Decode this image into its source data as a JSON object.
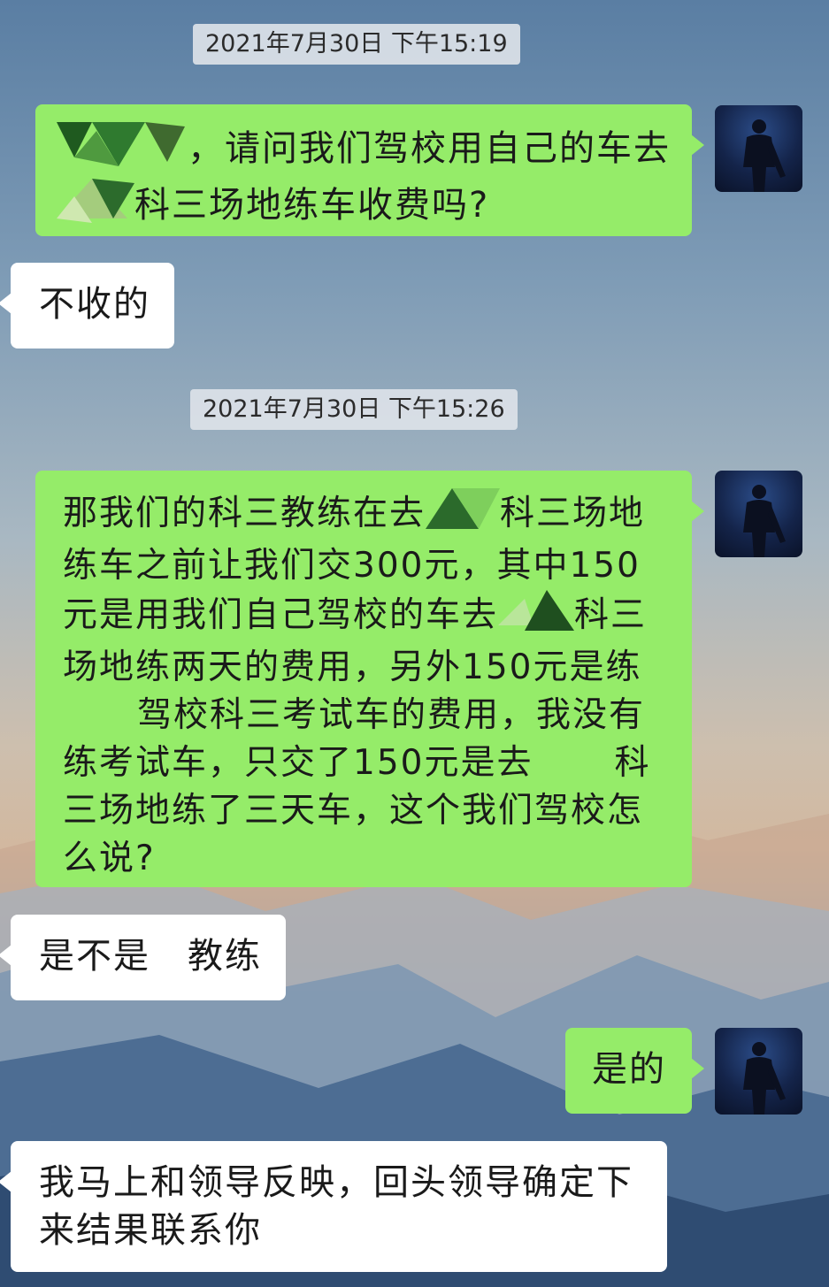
{
  "timestamps": [
    "2021年7月30日 下午15:19",
    "2021年7月30日 下午15:26"
  ],
  "messages": {
    "m1": {
      "a": "，请问我们驾校用自己的车去",
      "b": "科三场地练车收费吗?"
    },
    "m2": "不收的",
    "m3": {
      "l1a": "那我们的科三教练在去",
      "l1b": "科三场地",
      "l2": "练车之前让我们交300元，其中150",
      "l3a": "元是用我们自己驾校的车去",
      "l3b": "科三",
      "l4": "场地练两天的费用，另外150元是练",
      "l5": "驾校科三考试车的费用，我没有",
      "l6a": "练考试车，只交了150元是去",
      "l6b": "科",
      "l7": "三场地练了三天车，这个我们驾校怎",
      "l8": "么说?"
    },
    "m4": {
      "a": "是不是",
      "b": "教练"
    },
    "m5": "是的",
    "m6": {
      "l1": "我马上和领导反映，回头领导确定下",
      "l2": "来结果联系你"
    }
  },
  "colors": {
    "sent_bubble": "#95ec69",
    "received_bubble": "#ffffff",
    "timestamp_bg": "#dce2e8"
  },
  "icons": {
    "avatar": "user-avatar-icon",
    "redaction": "mosaic-redaction-icon"
  }
}
